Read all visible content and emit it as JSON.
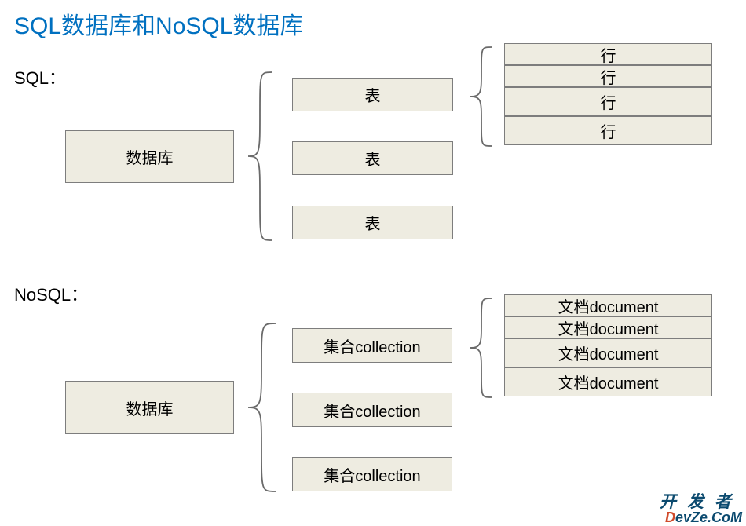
{
  "title": "SQL数据库和NoSQL数据库",
  "sql": {
    "label": "SQL：",
    "database": "数据库",
    "tables": [
      "表",
      "表",
      "表"
    ],
    "rows": [
      "行",
      "行",
      "行",
      "行"
    ]
  },
  "nosql": {
    "label": "NoSQL：",
    "database": "数据库",
    "collections": [
      "集合collection",
      "集合collection",
      "集合collection"
    ],
    "documents": [
      "文档document",
      "文档document",
      "文档document",
      "文档document"
    ]
  },
  "watermark": {
    "line1": "开发者",
    "line2a": "D",
    "line2b": "evZe.CoM"
  }
}
